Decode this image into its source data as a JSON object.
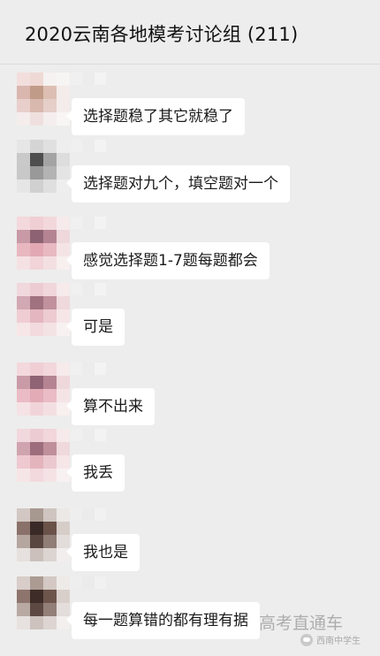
{
  "chat": {
    "title": "2020云南各地模考讨论组 (211)"
  },
  "messages": [
    {
      "text": "选择题稳了其它就稳了",
      "avatar_colors": [
        "#f3dede",
        "#efd9d5",
        "#f6f2f1",
        "#f7f4f4",
        "#d9b6ae",
        "#c09b88",
        "#dcbfb2",
        "#f3ecea",
        "#e9cfcb",
        "#d9b8ae",
        "#e5cfc8",
        "#f4eceb",
        "#f5ecec",
        "#efe0df",
        "#f5eeee",
        "#f8f5f5"
      ],
      "nick_colors": [
        "#f0f0f0",
        "#ececec",
        "#f3f3f3"
      ]
    },
    {
      "text": "选择题对九个，填空题对一个",
      "avatar_colors": [
        "#e6e6e6",
        "#d5d5d5",
        "#e0e0e0",
        "#eeeeee",
        "#c9c9c9",
        "#4e4e4e",
        "#a4a4a4",
        "#dddddd",
        "#c8c8c8",
        "#999999",
        "#b3b3b3",
        "#e4e4e4",
        "#e6e6e6",
        "#d0d0d0",
        "#dfdfdf",
        "#eeeeee"
      ],
      "nick_colors": [
        "#f0f0f0",
        "#ececec",
        "#f3f3f3"
      ]
    },
    {
      "text": "感觉选择题1-7题每题都会",
      "avatar_colors": [
        "#f3d8dc",
        "#f0cfd4",
        "#f2d8db",
        "#f6eaeb",
        "#c79aa5",
        "#8d6373",
        "#b58493",
        "#eed8db",
        "#e9b7c0",
        "#e2a9b4",
        "#e9b9c2",
        "#f5e4e6",
        "#f5e1e4",
        "#f1d3d8",
        "#f3dfe2",
        "#f8efef"
      ],
      "nick_colors": [
        "#f0f0f0",
        "#ececec",
        "#f3f3f3"
      ]
    },
    {
      "text": "可是",
      "avatar_colors": [
        "#f1d8dc",
        "#ecccd2",
        "#f1d6db",
        "#f6eaeb",
        "#d2a8b2",
        "#a0717f",
        "#c1919e",
        "#efd9dc",
        "#efcdd3",
        "#e4b6bf",
        "#eccbd1",
        "#f6e6e8",
        "#f6e6e8",
        "#f2dade",
        "#f4e3e5",
        "#f8f1f1"
      ],
      "nick_colors": [
        "#f0f0f0",
        "#ececec",
        "#f3f3f3"
      ]
    },
    {
      "text": "算不出来",
      "avatar_colors": [
        "#f3d9dd",
        "#efced4",
        "#f2d7dc",
        "#f6eaeb",
        "#c99ba7",
        "#8f6373",
        "#b58493",
        "#efd8dc",
        "#ebbcc5",
        "#e2abb6",
        "#eabcc5",
        "#f5e4e6",
        "#f5e2e5",
        "#f1d4d9",
        "#f3dfe2",
        "#f8efef"
      ],
      "nick_colors": [
        "#f0f0f0",
        "#ececec",
        "#f3f3f3"
      ]
    },
    {
      "text": "我丢",
      "avatar_colors": [
        "#f1d8dc",
        "#ecccd2",
        "#f1d6db",
        "#f6eaeb",
        "#d0a4af",
        "#9c6d7c",
        "#bf8f9c",
        "#efd9dc",
        "#eec9d0",
        "#e4b4bd",
        "#ebc8cf",
        "#f6e6e8",
        "#f6e5e7",
        "#f2d9dd",
        "#f4e2e5",
        "#f8f1f1"
      ],
      "nick_colors": [
        "#f0f0f0",
        "#ececec",
        "#f3f3f3"
      ]
    },
    {
      "text": "我也是",
      "avatar_colors": [
        "#d2c7c3",
        "#a79890",
        "#cfc4bf",
        "#ece8e6",
        "#8a716a",
        "#3a2a27",
        "#6a5249",
        "#d6cdc9",
        "#b5a6a0",
        "#5a4640",
        "#8f7d76",
        "#e2dcda",
        "#e6e0de",
        "#cbc0bc",
        "#dcd4d1",
        "#f1eeed"
      ],
      "nick_colors": [
        "#eeeeee",
        "#ebebeb",
        "#f1f1f1"
      ]
    },
    {
      "text": "每一题算错的都有理有据",
      "avatar_colors": [
        "#d8cdc8",
        "#ab9b93",
        "#d3c8c3",
        "#eeeae8",
        "#8d756d",
        "#3d2c28",
        "#6d554c",
        "#d8cfcb",
        "#b8a9a3",
        "#5d4943",
        "#927f78",
        "#e3dddb",
        "#e7e1df",
        "#cdc2be",
        "#ddd5d2",
        "#f2efee"
      ],
      "nick_colors": [
        "#eeeeee",
        "#ebebeb",
        "#f1f1f1"
      ]
    }
  ],
  "watermark": {
    "text": "高考直通车",
    "badge_text": "西南中学生"
  }
}
